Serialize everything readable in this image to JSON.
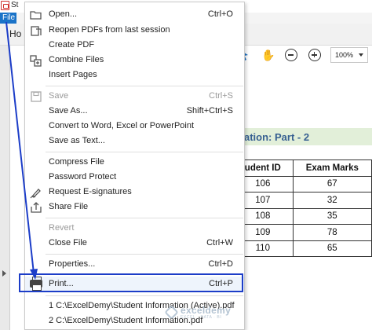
{
  "window": {
    "title": "St",
    "file_menu": "File",
    "home_tab": "Ho"
  },
  "toolbar": {
    "zoom": "100%"
  },
  "document": {
    "heading": "ation: Part - 2",
    "table": {
      "headers": [
        "udent ID",
        "Exam Marks"
      ],
      "rows": [
        [
          "106",
          "67"
        ],
        [
          "107",
          "32"
        ],
        [
          "108",
          "35"
        ],
        [
          "109",
          "78"
        ],
        [
          "110",
          "65"
        ]
      ]
    }
  },
  "menu": {
    "items": [
      {
        "label": "Open...",
        "shortcut": "Ctrl+O",
        "icon": "open-folder-icon",
        "disabled": false
      },
      {
        "label": "Reopen PDFs from last session",
        "shortcut": "",
        "icon": "reopen-icon",
        "disabled": false
      },
      {
        "label": "Create PDF",
        "shortcut": "",
        "icon": "",
        "disabled": false
      },
      {
        "label": "Combine Files",
        "shortcut": "",
        "icon": "combine-files-icon",
        "disabled": false
      },
      {
        "label": "Insert Pages",
        "shortcut": "",
        "icon": "",
        "disabled": false
      },
      {
        "label": "Save",
        "shortcut": "Ctrl+S",
        "icon": "save-icon",
        "disabled": true
      },
      {
        "label": "Save As...",
        "shortcut": "Shift+Ctrl+S",
        "icon": "",
        "disabled": false
      },
      {
        "label": "Convert to Word, Excel or PowerPoint",
        "shortcut": "",
        "icon": "",
        "disabled": false
      },
      {
        "label": "Save as Text...",
        "shortcut": "",
        "icon": "",
        "disabled": false
      },
      {
        "label": "Compress File",
        "shortcut": "",
        "icon": "",
        "disabled": false
      },
      {
        "label": "Password Protect",
        "shortcut": "",
        "icon": "",
        "disabled": false
      },
      {
        "label": "Request E-signatures",
        "shortcut": "",
        "icon": "signature-pen-icon",
        "disabled": false
      },
      {
        "label": "Share File",
        "shortcut": "",
        "icon": "share-icon",
        "disabled": false
      },
      {
        "label": "Revert",
        "shortcut": "",
        "icon": "",
        "disabled": true
      },
      {
        "label": "Close File",
        "shortcut": "Ctrl+W",
        "icon": "",
        "disabled": false
      },
      {
        "label": "Properties...",
        "shortcut": "Ctrl+D",
        "icon": "",
        "disabled": false
      },
      {
        "label": "Print...",
        "shortcut": "Ctrl+P",
        "icon": "printer-icon",
        "disabled": false
      },
      {
        "label": "1 C:\\ExcelDemy\\Student Information (Active).pdf",
        "shortcut": "",
        "icon": "",
        "disabled": false
      },
      {
        "label": "2 C:\\ExcelDemy\\Student Information.pdf",
        "shortcut": "",
        "icon": "",
        "disabled": false
      }
    ]
  },
  "watermark": {
    "name": "exceldemy",
    "tagline": "EXCEL · DATA · BI"
  },
  "colors": {
    "file_menu": "#1a73c8",
    "annotation": "#1c3dc8",
    "heading_band": "#e2efd9",
    "heading_text": "#365f91"
  }
}
